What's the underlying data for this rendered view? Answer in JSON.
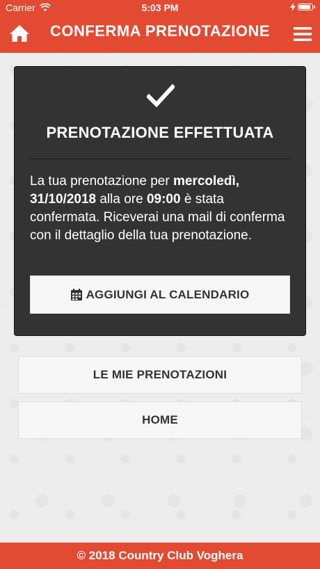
{
  "status_bar": {
    "carrier": "Carrier",
    "time": "5:03 PM"
  },
  "header": {
    "title": "CONFERMA PRENOTAZIONE"
  },
  "card": {
    "title": "PRENOTAZIONE EFFETTUATA",
    "message_parts": {
      "part1": "La tua prenotazione per ",
      "day": "mercoledì, 31/10/2018",
      "part2": " alla ore ",
      "time": "09:00",
      "part3": " è stata confermata. Riceverai una mail di conferma con il dettaglio della tua prenotazione."
    },
    "calendar_button": "AGGIUNGI AL CALENDARIO"
  },
  "buttons": {
    "my_bookings": "LE MIE PRENOTAZIONI",
    "home": "HOME"
  },
  "footer": {
    "text": "© 2018 Country Club Voghera"
  },
  "colors": {
    "accent": "#e24a32",
    "card_bg": "#333333",
    "button_bg": "#f6f6f6"
  },
  "icons": {
    "home": "home-icon",
    "menu": "menu-icon",
    "check": "check-icon",
    "calendar": "calendar-icon",
    "wifi": "wifi-icon",
    "battery": "battery-icon"
  }
}
